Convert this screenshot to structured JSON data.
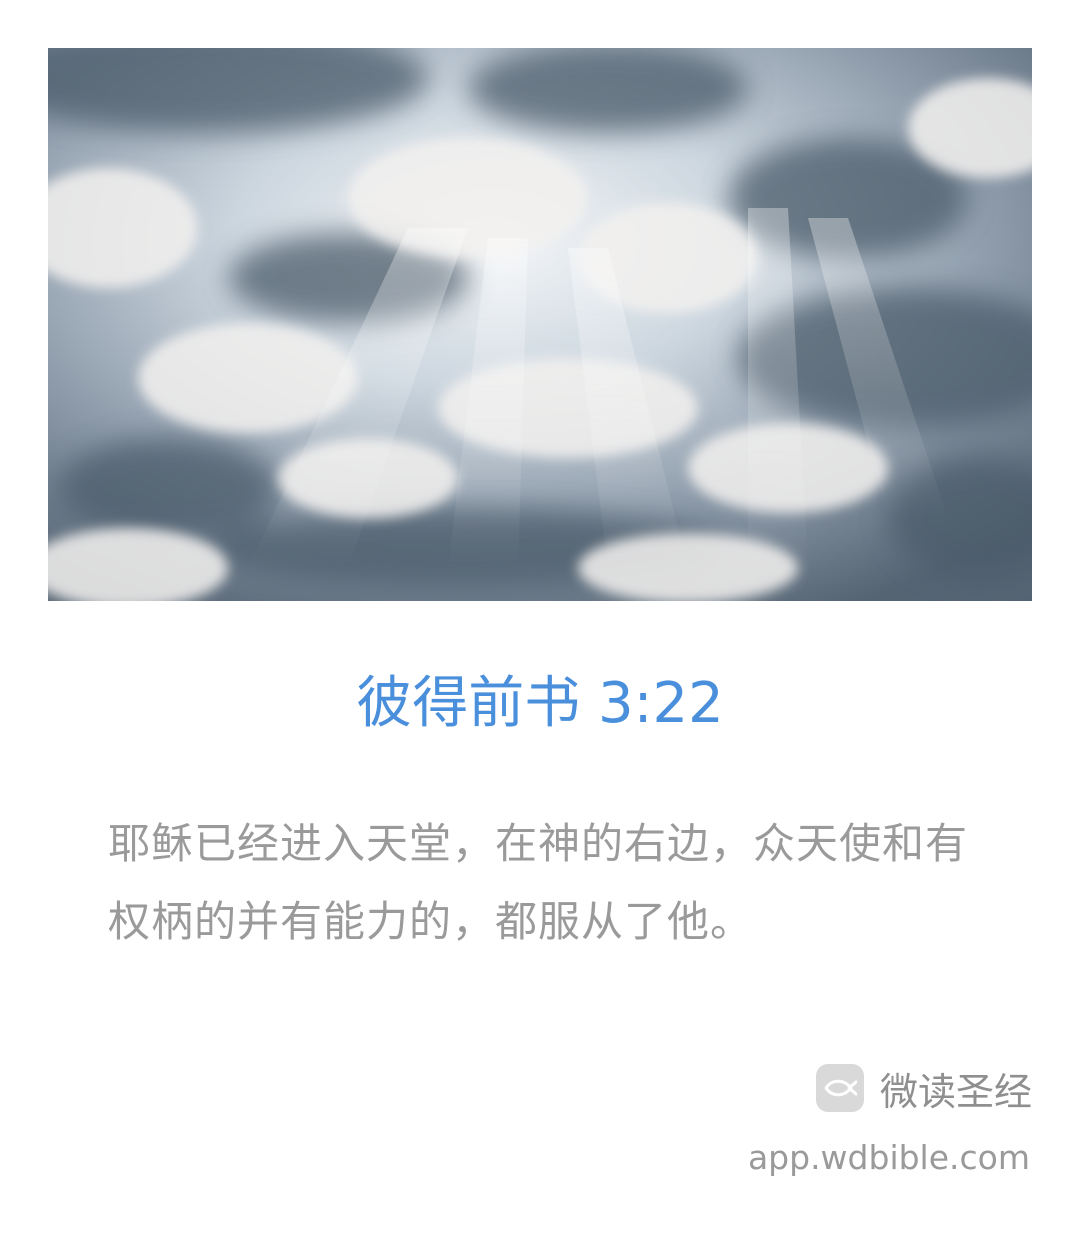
{
  "hero": {
    "image_icon": "cloudy-sky-with-sunbeams"
  },
  "verse": {
    "reference": "彼得前书 3:22",
    "text": "耶稣已经进入天堂，在神的右边，众天使和有权柄的并有能力的，都服从了他。"
  },
  "footer": {
    "logo_icon": "fish-icon",
    "brand_name": "微读圣经",
    "url": "app.wdbible.com"
  },
  "colors": {
    "reference": "#4a8fdb",
    "verse_text": "#9a9a9a",
    "brand_text": "#8f8f8f",
    "logo_bg": "#d9d9d9"
  }
}
